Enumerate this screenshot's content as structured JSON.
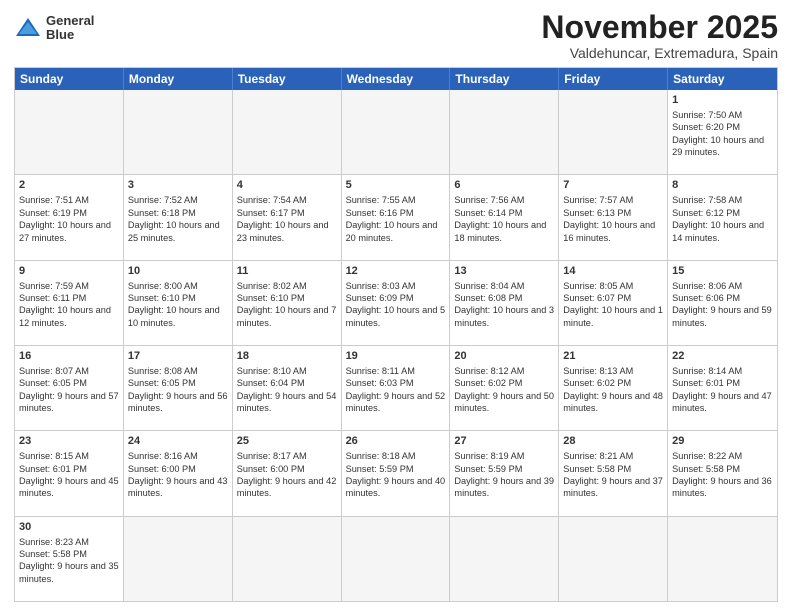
{
  "header": {
    "logo": {
      "line1": "General",
      "line2": "Blue"
    },
    "month": "November 2025",
    "location": "Valdehuncar, Extremadura, Spain"
  },
  "days_of_week": [
    "Sunday",
    "Monday",
    "Tuesday",
    "Wednesday",
    "Thursday",
    "Friday",
    "Saturday"
  ],
  "rows": [
    [
      {
        "day": "",
        "empty": true
      },
      {
        "day": "",
        "empty": true
      },
      {
        "day": "",
        "empty": true
      },
      {
        "day": "",
        "empty": true
      },
      {
        "day": "",
        "empty": true
      },
      {
        "day": "",
        "empty": true
      },
      {
        "day": "1",
        "sunrise": "7:50 AM",
        "sunset": "6:20 PM",
        "daylight": "10 hours and 29 minutes."
      }
    ],
    [
      {
        "day": "2",
        "sunrise": "7:51 AM",
        "sunset": "6:19 PM",
        "daylight": "10 hours and 27 minutes."
      },
      {
        "day": "3",
        "sunrise": "7:52 AM",
        "sunset": "6:18 PM",
        "daylight": "10 hours and 25 minutes."
      },
      {
        "day": "4",
        "sunrise": "7:54 AM",
        "sunset": "6:17 PM",
        "daylight": "10 hours and 23 minutes."
      },
      {
        "day": "5",
        "sunrise": "7:55 AM",
        "sunset": "6:16 PM",
        "daylight": "10 hours and 20 minutes."
      },
      {
        "day": "6",
        "sunrise": "7:56 AM",
        "sunset": "6:14 PM",
        "daylight": "10 hours and 18 minutes."
      },
      {
        "day": "7",
        "sunrise": "7:57 AM",
        "sunset": "6:13 PM",
        "daylight": "10 hours and 16 minutes."
      },
      {
        "day": "8",
        "sunrise": "7:58 AM",
        "sunset": "6:12 PM",
        "daylight": "10 hours and 14 minutes."
      }
    ],
    [
      {
        "day": "9",
        "sunrise": "7:59 AM",
        "sunset": "6:11 PM",
        "daylight": "10 hours and 12 minutes."
      },
      {
        "day": "10",
        "sunrise": "8:00 AM",
        "sunset": "6:10 PM",
        "daylight": "10 hours and 10 minutes."
      },
      {
        "day": "11",
        "sunrise": "8:02 AM",
        "sunset": "6:10 PM",
        "daylight": "10 hours and 7 minutes."
      },
      {
        "day": "12",
        "sunrise": "8:03 AM",
        "sunset": "6:09 PM",
        "daylight": "10 hours and 5 minutes."
      },
      {
        "day": "13",
        "sunrise": "8:04 AM",
        "sunset": "6:08 PM",
        "daylight": "10 hours and 3 minutes."
      },
      {
        "day": "14",
        "sunrise": "8:05 AM",
        "sunset": "6:07 PM",
        "daylight": "10 hours and 1 minute."
      },
      {
        "day": "15",
        "sunrise": "8:06 AM",
        "sunset": "6:06 PM",
        "daylight": "9 hours and 59 minutes."
      }
    ],
    [
      {
        "day": "16",
        "sunrise": "8:07 AM",
        "sunset": "6:05 PM",
        "daylight": "9 hours and 57 minutes."
      },
      {
        "day": "17",
        "sunrise": "8:08 AM",
        "sunset": "6:05 PM",
        "daylight": "9 hours and 56 minutes."
      },
      {
        "day": "18",
        "sunrise": "8:10 AM",
        "sunset": "6:04 PM",
        "daylight": "9 hours and 54 minutes."
      },
      {
        "day": "19",
        "sunrise": "8:11 AM",
        "sunset": "6:03 PM",
        "daylight": "9 hours and 52 minutes."
      },
      {
        "day": "20",
        "sunrise": "8:12 AM",
        "sunset": "6:02 PM",
        "daylight": "9 hours and 50 minutes."
      },
      {
        "day": "21",
        "sunrise": "8:13 AM",
        "sunset": "6:02 PM",
        "daylight": "9 hours and 48 minutes."
      },
      {
        "day": "22",
        "sunrise": "8:14 AM",
        "sunset": "6:01 PM",
        "daylight": "9 hours and 47 minutes."
      }
    ],
    [
      {
        "day": "23",
        "sunrise": "8:15 AM",
        "sunset": "6:01 PM",
        "daylight": "9 hours and 45 minutes."
      },
      {
        "day": "24",
        "sunrise": "8:16 AM",
        "sunset": "6:00 PM",
        "daylight": "9 hours and 43 minutes."
      },
      {
        "day": "25",
        "sunrise": "8:17 AM",
        "sunset": "6:00 PM",
        "daylight": "9 hours and 42 minutes."
      },
      {
        "day": "26",
        "sunrise": "8:18 AM",
        "sunset": "5:59 PM",
        "daylight": "9 hours and 40 minutes."
      },
      {
        "day": "27",
        "sunrise": "8:19 AM",
        "sunset": "5:59 PM",
        "daylight": "9 hours and 39 minutes."
      },
      {
        "day": "28",
        "sunrise": "8:21 AM",
        "sunset": "5:58 PM",
        "daylight": "9 hours and 37 minutes."
      },
      {
        "day": "29",
        "sunrise": "8:22 AM",
        "sunset": "5:58 PM",
        "daylight": "9 hours and 36 minutes."
      }
    ],
    [
      {
        "day": "30",
        "sunrise": "8:23 AM",
        "sunset": "5:58 PM",
        "daylight": "9 hours and 35 minutes."
      },
      {
        "day": "",
        "empty": true
      },
      {
        "day": "",
        "empty": true
      },
      {
        "day": "",
        "empty": true
      },
      {
        "day": "",
        "empty": true
      },
      {
        "day": "",
        "empty": true
      },
      {
        "day": "",
        "empty": true
      }
    ]
  ]
}
